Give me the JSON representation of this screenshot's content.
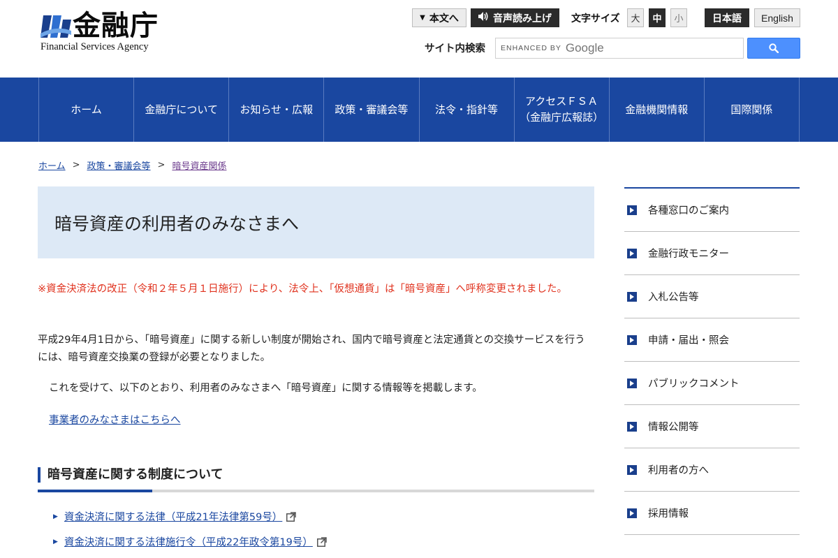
{
  "logo": {
    "jp": "金融庁",
    "en": "Financial Services Agency"
  },
  "util": {
    "honbun": "本文へ",
    "voice": "音声読み上げ",
    "font_size_label": "文字サイズ",
    "font_sizes": [
      "大",
      "中",
      "小"
    ],
    "lang_ja": "日本語",
    "lang_en": "English"
  },
  "search": {
    "label": "サイト内検索",
    "enhanced": "ENHANCED BY",
    "google": "Google"
  },
  "nav": [
    {
      "label": "ホーム"
    },
    {
      "label": "金融庁について"
    },
    {
      "label": "お知らせ・広報"
    },
    {
      "label": "政策・審議会等"
    },
    {
      "label": "法令・指針等"
    },
    {
      "line1": "アクセスＦＳＡ",
      "line2": "（金融庁広報誌）"
    },
    {
      "label": "金融機関情報"
    },
    {
      "label": "国際関係"
    }
  ],
  "breadcrumb": {
    "home": "ホーム",
    "policy": "政策・審議会等",
    "current": "暗号資産関係",
    "sep": ">"
  },
  "main": {
    "title": "暗号資産の利用者のみなさまへ",
    "notice": "※資金決済法の改正（令和２年５月１日施行）により、法令上、「仮想通貨」は「暗号資産」へ呼称変更されました。",
    "para1": "平成29年4月1日から、「暗号資産」に関する新しい制度が開始され、国内で暗号資産と法定通貨との交換サービスを行うには、暗号資産交換業の登録が必要となりました。",
    "para2": "これを受けて、以下のとおり、利用者のみなさまへ「暗号資産」に関する情報等を掲載します。",
    "link_business": "事業者のみなさまはこちらへ",
    "section_title": "暗号資産に関する制度について",
    "laws": [
      "資金決済に関する法律（平成21年法律第59号）",
      "資金決済に関する法律施行令（平成22年政令第19号）"
    ]
  },
  "sidebar": [
    "各種窓口のご案内",
    "金融行政モニター",
    "入札公告等",
    "申請・届出・照会",
    "パブリックコメント",
    "情報公開等",
    "利用者の方へ",
    "採用情報"
  ]
}
